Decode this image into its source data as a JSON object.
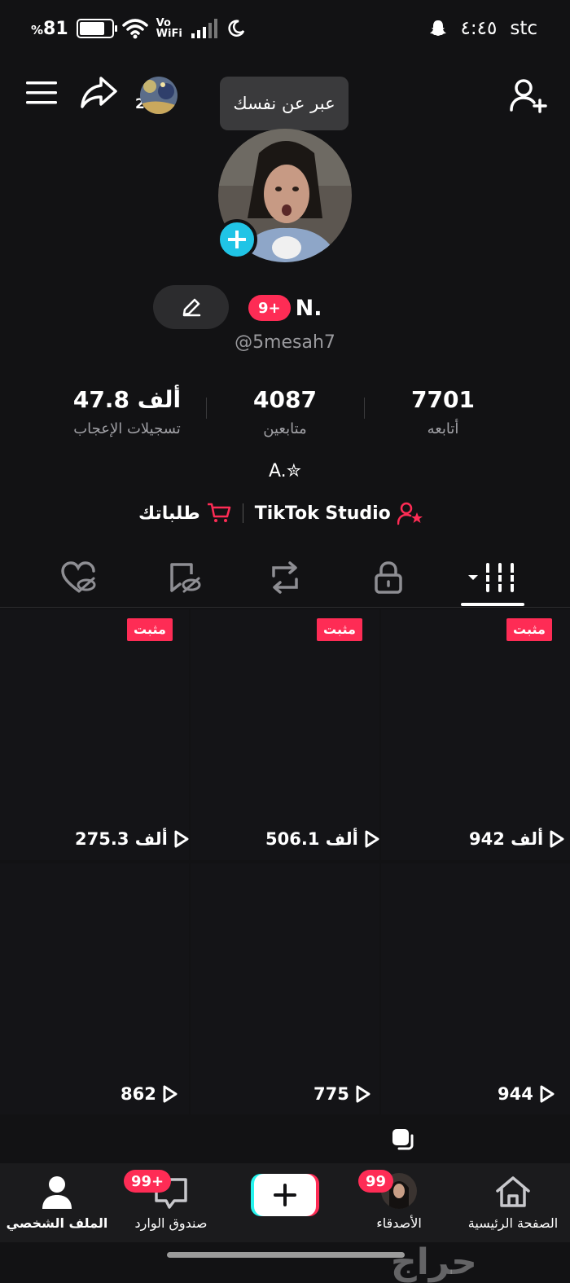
{
  "status_bar": {
    "battery": "81",
    "battery_symbol": "%",
    "vo": "Vo",
    "wifi": "WiFi",
    "time": "٤:٤٥",
    "carrier": "stc"
  },
  "header": {
    "followers_count_badge": "2",
    "tooltip": "عبر عن نفسك"
  },
  "profile": {
    "notif_pill": "9+",
    "name": "N.",
    "handle": "@5mesah7",
    "bio": "A.✮"
  },
  "stats": [
    {
      "value": "47.8 ألف",
      "label": "تسجيلات الإعجاب"
    },
    {
      "value": "4087",
      "label": "متابعين"
    },
    {
      "value": "7701",
      "label": "أتابعه"
    }
  ],
  "links": {
    "orders": "طلباتك",
    "studio": "TikTok Studio"
  },
  "tabs": [
    "videos",
    "private",
    "reposts",
    "saved",
    "liked"
  ],
  "pinned_label": "مثبت",
  "videos": [
    {
      "views": "275.3 ألف",
      "pinned": true
    },
    {
      "views": "506.1 ألف",
      "pinned": true
    },
    {
      "views": "942 ألف",
      "pinned": true
    },
    {
      "views": "862",
      "pinned": false
    },
    {
      "views": "775",
      "pinned": false
    },
    {
      "views": "944",
      "pinned": false
    }
  ],
  "bottom_nav": {
    "profile": "الملف الشخصي",
    "inbox": "صندوق الوارد",
    "inbox_badge": "99+",
    "friends": "الأصدقاء",
    "friends_badge": "99",
    "home": "الصفحة الرئيسية"
  },
  "watermark": "حراج",
  "colors": {
    "accent": "#fe2c55",
    "cyan": "#20c4e6",
    "background": "#121214"
  }
}
